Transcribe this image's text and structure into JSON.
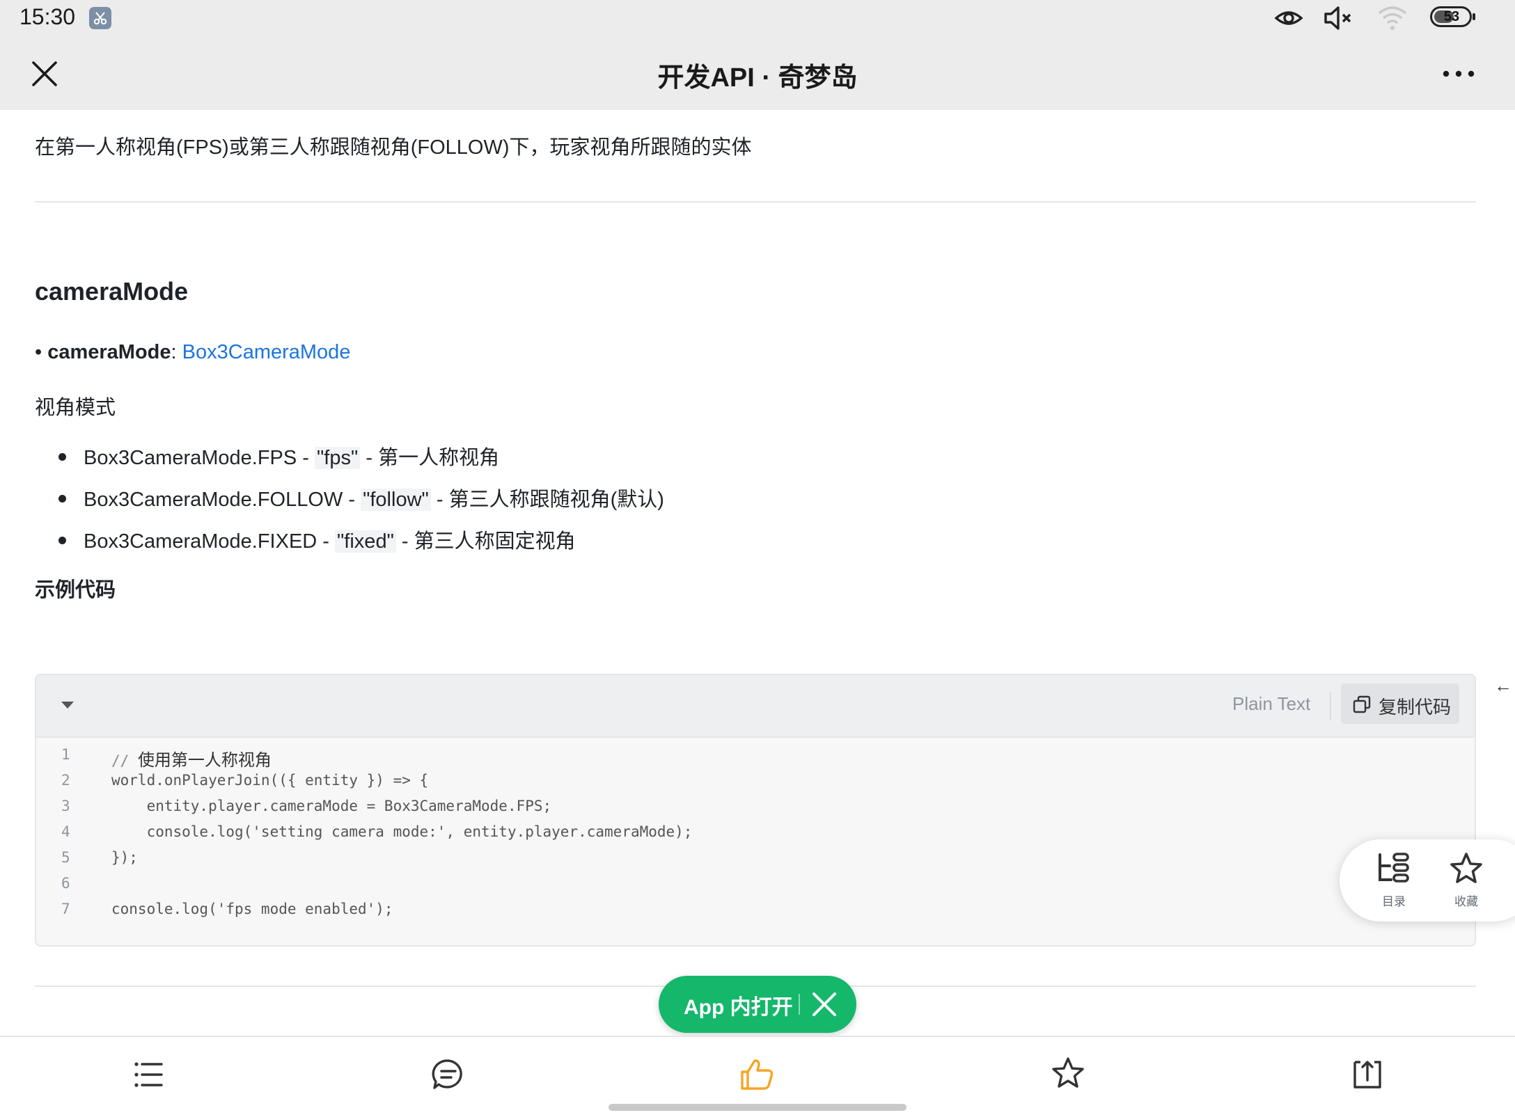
{
  "status_bar": {
    "time": "15:30",
    "battery": "53",
    "icons": [
      "scissors-app-icon",
      "eye-icon",
      "mute-icon",
      "wifi-icon",
      "battery-icon"
    ]
  },
  "nav": {
    "title": "开发API · 奇梦岛",
    "close_icon": "close-icon",
    "more_icon": "more-icon"
  },
  "article": {
    "intro": "在第一人称视角(FPS)或第三人称跟随视角(FOLLOW)下，玩家视角所跟随的实体",
    "section_title": "cameraMode",
    "property": {
      "bullet": "•",
      "name": "cameraMode",
      "colon": ":",
      "type": "Box3CameraMode"
    },
    "description": "视角模式",
    "modes": [
      {
        "prefix": "Box3CameraMode.FPS - ",
        "value": "\"fps\"",
        "suffix": " - 第一人称视角"
      },
      {
        "prefix": "Box3CameraMode.FOLLOW - ",
        "value": "\"follow\"",
        "suffix": " - 第三人称跟随视角(默认)"
      },
      {
        "prefix": "Box3CameraMode.FIXED - ",
        "value": "\"fixed\"",
        "suffix": " - 第三人称固定视角"
      }
    ],
    "example_label": "示例代码"
  },
  "code_block": {
    "language": "Plain Text",
    "copy_label": "复制代码",
    "lines": [
      {
        "n": "1",
        "comment": "// ",
        "text": "使用第一人称视角"
      },
      {
        "n": "2",
        "text": "world.onPlayerJoin(({ entity }) => {"
      },
      {
        "n": "3",
        "text": "    entity.player.cameraMode = Box3CameraMode.FPS;"
      },
      {
        "n": "4",
        "text": "    console.log('setting camera mode:', entity.player.cameraMode);"
      },
      {
        "n": "5",
        "text": "});"
      },
      {
        "n": "6",
        "text": ""
      },
      {
        "n": "7",
        "text": "console.log('fps mode enabled');"
      }
    ]
  },
  "edge_glyph": "←→",
  "floating_panel": {
    "toc_label": "目录",
    "fav_label": "收藏"
  },
  "app_open": {
    "label": "App 内打开"
  },
  "bottom_bar": {
    "items": [
      "list-icon",
      "comment-icon",
      "like-icon",
      "star-icon",
      "share-icon"
    ],
    "like_color": "#f5a623"
  }
}
